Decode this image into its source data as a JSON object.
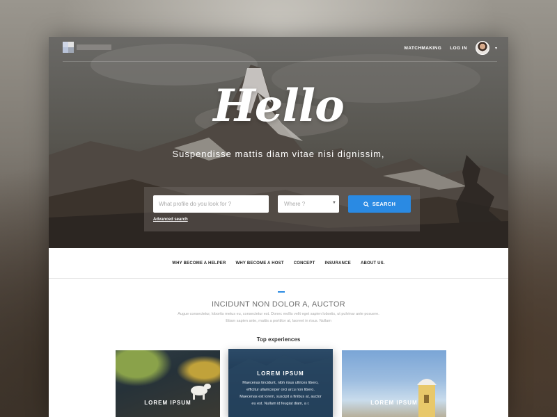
{
  "header": {
    "nav": [
      "MATCHMAKING",
      "LOG IN"
    ],
    "caret": "▾"
  },
  "hero": {
    "title": "Hello",
    "subtitle": "Suspendisse mattis diam vitae nisi dignissim,",
    "search": {
      "profile_placeholder": "What profile do you look for ?",
      "where_placeholder": "Where ?",
      "where_arrow": "▼",
      "button_label": "SEARCH",
      "advanced_link": "Advanced search"
    }
  },
  "menu": {
    "items": [
      "WHY BECOME A HELPER",
      "WHY BECOME A HOST",
      "CONCEPT",
      "INSURANCE",
      "ABOUT US."
    ]
  },
  "section": {
    "title": "INCIDUNT NON DOLOR A, AUCTOR",
    "description": "Augue consectetur, lobortis metus eu, consectetur est. Donec mollis velit eget sapien lobortis, ut pulvinar ante posuere. Etiam sapien ante, mattis a porttitor at, laoreet in risus. Nullam",
    "experiences_heading": "Top experiences"
  },
  "cards": [
    {
      "label": "LOREM IPSUM"
    },
    {
      "title": "LOREM IPSUM",
      "body": "Maecenas tincidunt, nibh risus ultrices libero, efficitur ullamcorper orci arcu non libero. Maecenas est lorem, suscipit a finibus at, auctor eu est. Nullam id feugiat diam, a r."
    },
    {
      "label": "LOREM IPSUM"
    }
  ],
  "colors": {
    "accent": "#2a8ae3",
    "menu_text": "#222222",
    "section_title": "#6f6f6f"
  },
  "icons": {
    "search": "search-icon",
    "avatar": "user-avatar"
  }
}
